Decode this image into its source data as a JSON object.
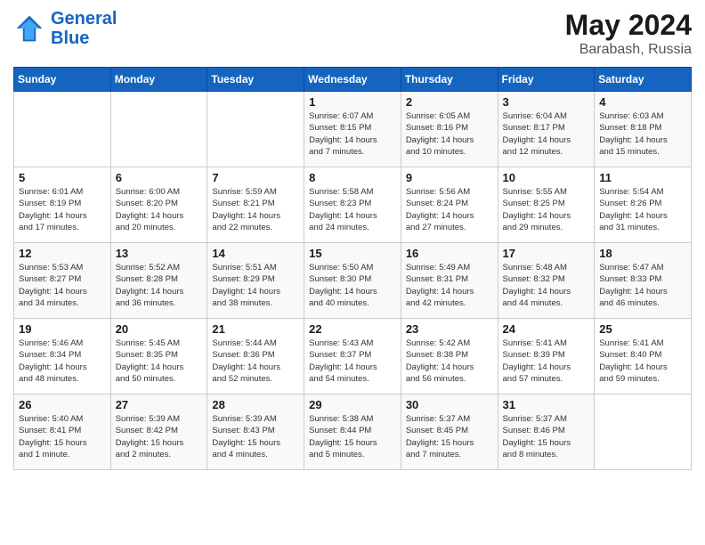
{
  "header": {
    "logo_line1": "General",
    "logo_line2": "Blue",
    "month": "May 2024",
    "location": "Barabash, Russia"
  },
  "days_of_week": [
    "Sunday",
    "Monday",
    "Tuesday",
    "Wednesday",
    "Thursday",
    "Friday",
    "Saturday"
  ],
  "weeks": [
    [
      {
        "day": "",
        "info": ""
      },
      {
        "day": "",
        "info": ""
      },
      {
        "day": "",
        "info": ""
      },
      {
        "day": "1",
        "info": "Sunrise: 6:07 AM\nSunset: 8:15 PM\nDaylight: 14 hours\nand 7 minutes."
      },
      {
        "day": "2",
        "info": "Sunrise: 6:05 AM\nSunset: 8:16 PM\nDaylight: 14 hours\nand 10 minutes."
      },
      {
        "day": "3",
        "info": "Sunrise: 6:04 AM\nSunset: 8:17 PM\nDaylight: 14 hours\nand 12 minutes."
      },
      {
        "day": "4",
        "info": "Sunrise: 6:03 AM\nSunset: 8:18 PM\nDaylight: 14 hours\nand 15 minutes."
      }
    ],
    [
      {
        "day": "5",
        "info": "Sunrise: 6:01 AM\nSunset: 8:19 PM\nDaylight: 14 hours\nand 17 minutes."
      },
      {
        "day": "6",
        "info": "Sunrise: 6:00 AM\nSunset: 8:20 PM\nDaylight: 14 hours\nand 20 minutes."
      },
      {
        "day": "7",
        "info": "Sunrise: 5:59 AM\nSunset: 8:21 PM\nDaylight: 14 hours\nand 22 minutes."
      },
      {
        "day": "8",
        "info": "Sunrise: 5:58 AM\nSunset: 8:23 PM\nDaylight: 14 hours\nand 24 minutes."
      },
      {
        "day": "9",
        "info": "Sunrise: 5:56 AM\nSunset: 8:24 PM\nDaylight: 14 hours\nand 27 minutes."
      },
      {
        "day": "10",
        "info": "Sunrise: 5:55 AM\nSunset: 8:25 PM\nDaylight: 14 hours\nand 29 minutes."
      },
      {
        "day": "11",
        "info": "Sunrise: 5:54 AM\nSunset: 8:26 PM\nDaylight: 14 hours\nand 31 minutes."
      }
    ],
    [
      {
        "day": "12",
        "info": "Sunrise: 5:53 AM\nSunset: 8:27 PM\nDaylight: 14 hours\nand 34 minutes."
      },
      {
        "day": "13",
        "info": "Sunrise: 5:52 AM\nSunset: 8:28 PM\nDaylight: 14 hours\nand 36 minutes."
      },
      {
        "day": "14",
        "info": "Sunrise: 5:51 AM\nSunset: 8:29 PM\nDaylight: 14 hours\nand 38 minutes."
      },
      {
        "day": "15",
        "info": "Sunrise: 5:50 AM\nSunset: 8:30 PM\nDaylight: 14 hours\nand 40 minutes."
      },
      {
        "day": "16",
        "info": "Sunrise: 5:49 AM\nSunset: 8:31 PM\nDaylight: 14 hours\nand 42 minutes."
      },
      {
        "day": "17",
        "info": "Sunrise: 5:48 AM\nSunset: 8:32 PM\nDaylight: 14 hours\nand 44 minutes."
      },
      {
        "day": "18",
        "info": "Sunrise: 5:47 AM\nSunset: 8:33 PM\nDaylight: 14 hours\nand 46 minutes."
      }
    ],
    [
      {
        "day": "19",
        "info": "Sunrise: 5:46 AM\nSunset: 8:34 PM\nDaylight: 14 hours\nand 48 minutes."
      },
      {
        "day": "20",
        "info": "Sunrise: 5:45 AM\nSunset: 8:35 PM\nDaylight: 14 hours\nand 50 minutes."
      },
      {
        "day": "21",
        "info": "Sunrise: 5:44 AM\nSunset: 8:36 PM\nDaylight: 14 hours\nand 52 minutes."
      },
      {
        "day": "22",
        "info": "Sunrise: 5:43 AM\nSunset: 8:37 PM\nDaylight: 14 hours\nand 54 minutes."
      },
      {
        "day": "23",
        "info": "Sunrise: 5:42 AM\nSunset: 8:38 PM\nDaylight: 14 hours\nand 56 minutes."
      },
      {
        "day": "24",
        "info": "Sunrise: 5:41 AM\nSunset: 8:39 PM\nDaylight: 14 hours\nand 57 minutes."
      },
      {
        "day": "25",
        "info": "Sunrise: 5:41 AM\nSunset: 8:40 PM\nDaylight: 14 hours\nand 59 minutes."
      }
    ],
    [
      {
        "day": "26",
        "info": "Sunrise: 5:40 AM\nSunset: 8:41 PM\nDaylight: 15 hours\nand 1 minute."
      },
      {
        "day": "27",
        "info": "Sunrise: 5:39 AM\nSunset: 8:42 PM\nDaylight: 15 hours\nand 2 minutes."
      },
      {
        "day": "28",
        "info": "Sunrise: 5:39 AM\nSunset: 8:43 PM\nDaylight: 15 hours\nand 4 minutes."
      },
      {
        "day": "29",
        "info": "Sunrise: 5:38 AM\nSunset: 8:44 PM\nDaylight: 15 hours\nand 5 minutes."
      },
      {
        "day": "30",
        "info": "Sunrise: 5:37 AM\nSunset: 8:45 PM\nDaylight: 15 hours\nand 7 minutes."
      },
      {
        "day": "31",
        "info": "Sunrise: 5:37 AM\nSunset: 8:46 PM\nDaylight: 15 hours\nand 8 minutes."
      },
      {
        "day": "",
        "info": ""
      }
    ]
  ]
}
